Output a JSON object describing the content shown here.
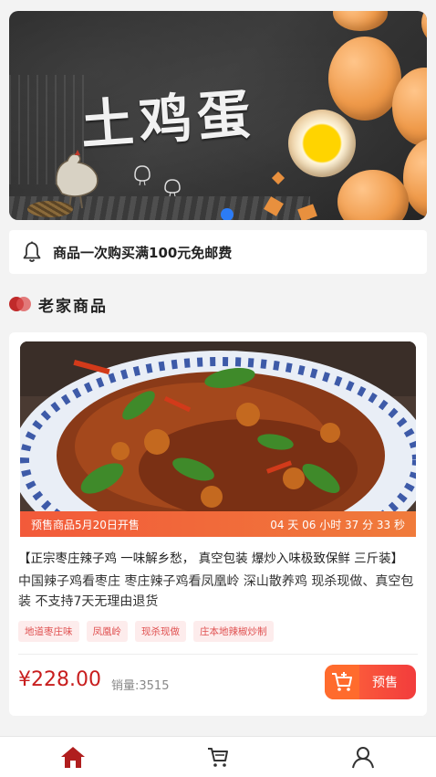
{
  "banner": {
    "title": "土鸡蛋",
    "carousel_active_index": 0
  },
  "notice": {
    "icon": "bell-icon",
    "text": "商品一次购买满100元免邮费"
  },
  "section": {
    "title": "老家商品"
  },
  "product": {
    "presale_label": "预售商品5月20日开售",
    "countdown": "04 天 06 小时 37 分 33 秒",
    "title": "【正宗枣庄辣子鸡 一味解乡愁， 真空包装 爆炒入味极致保鲜 三斤装】",
    "description": "中国辣子鸡看枣庄 枣庄辣子鸡看凤凰岭 深山散养鸡 现杀现做、真空包装 不支持7天无理由退货",
    "tags": [
      "地道枣庄味",
      "凤凰岭",
      "现杀现做",
      "庄本地辣椒炒制"
    ],
    "price": "¥228.00",
    "sales": "销量:3515",
    "button_label": "预售"
  },
  "nav": {
    "items": [
      {
        "icon": "home-icon",
        "active": true
      },
      {
        "icon": "cart-icon",
        "active": false
      },
      {
        "icon": "user-icon",
        "active": false
      }
    ]
  },
  "colors": {
    "accent": "#c81e1e",
    "presale_gradient_start": "#f25a3a",
    "carousel_dot": "#2c7cf6"
  }
}
